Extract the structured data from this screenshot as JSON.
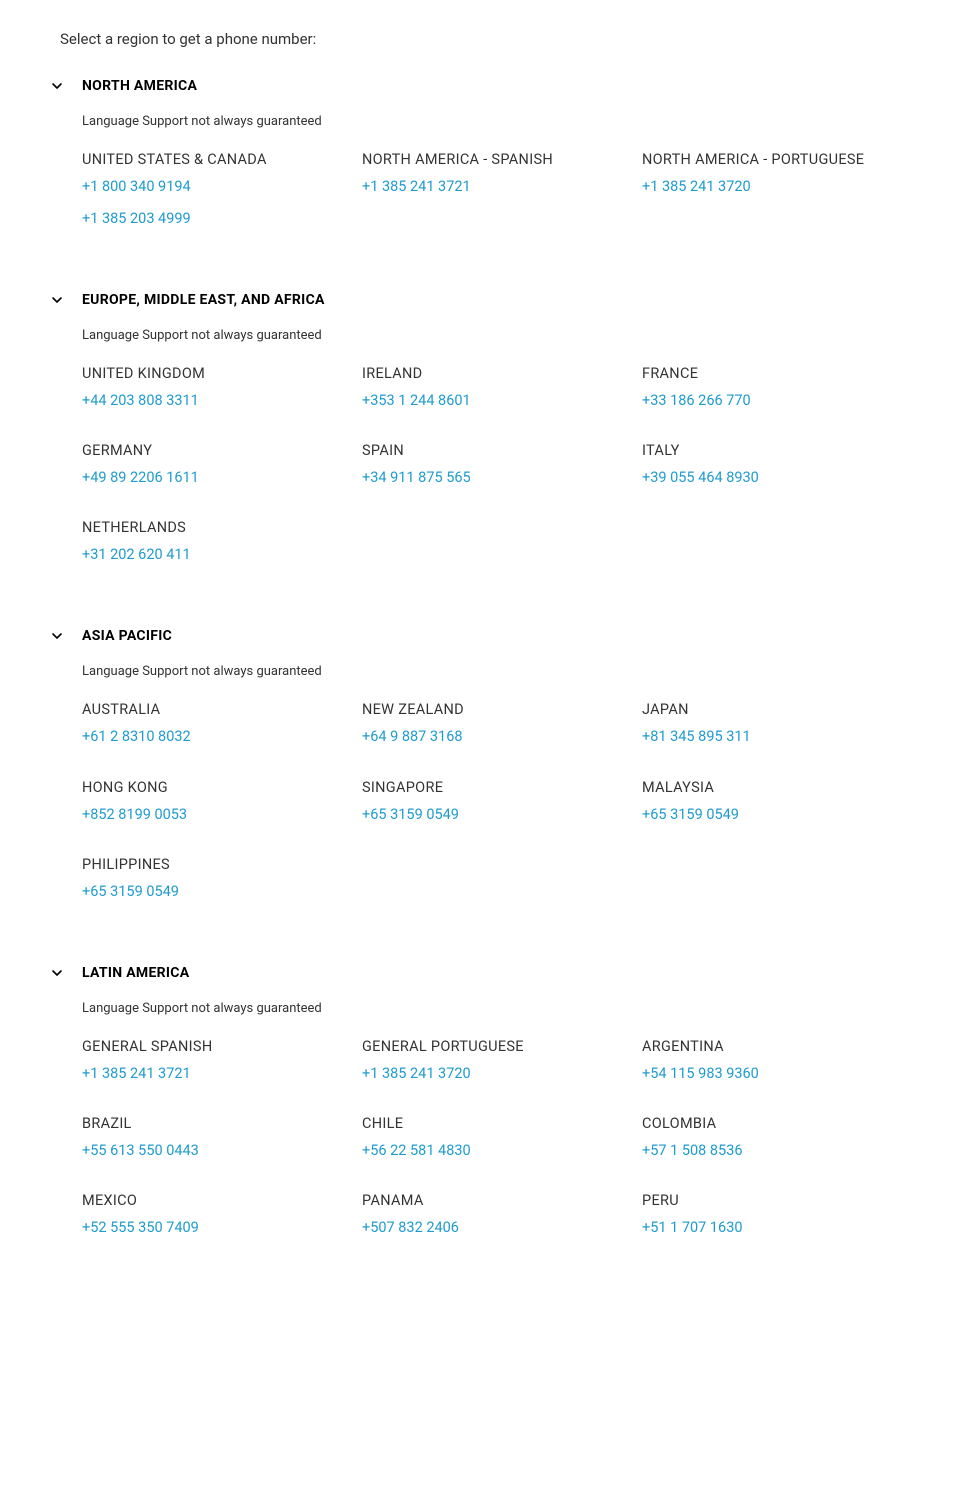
{
  "intro": "Select a region to get a phone number:",
  "note": "Language Support not always guaranteed",
  "regions": [
    {
      "title": "NORTH AMERICA",
      "countries": [
        {
          "name": "UNITED STATES & CANADA",
          "phones": [
            "+1 800 340 9194",
            "+1 385 203 4999"
          ]
        },
        {
          "name": "NORTH AMERICA - SPANISH",
          "phones": [
            "+1 385 241 3721"
          ]
        },
        {
          "name": "NORTH AMERICA - PORTUGUESE",
          "phones": [
            "+1 385 241 3720"
          ]
        }
      ]
    },
    {
      "title": "EUROPE, MIDDLE EAST, AND AFRICA",
      "countries": [
        {
          "name": "UNITED KINGDOM",
          "phones": [
            "+44 203 808 3311"
          ]
        },
        {
          "name": "IRELAND",
          "phones": [
            "+353 1 244 8601"
          ]
        },
        {
          "name": "FRANCE",
          "phones": [
            "+33 186 266 770"
          ]
        },
        {
          "name": "GERMANY",
          "phones": [
            "+49 89 2206 1611"
          ]
        },
        {
          "name": "SPAIN",
          "phones": [
            "+34 911 875 565"
          ]
        },
        {
          "name": "ITALY",
          "phones": [
            "+39 055 464 8930"
          ]
        },
        {
          "name": "NETHERLANDS",
          "phones": [
            "+31 202 620 411"
          ]
        }
      ]
    },
    {
      "title": "ASIA PACIFIC",
      "countries": [
        {
          "name": "AUSTRALIA",
          "phones": [
            "+61 2 8310 8032"
          ]
        },
        {
          "name": "NEW ZEALAND",
          "phones": [
            "+64 9 887 3168"
          ]
        },
        {
          "name": "JAPAN",
          "phones": [
            "+81 345 895 311"
          ]
        },
        {
          "name": "HONG KONG",
          "phones": [
            "+852 8199 0053"
          ]
        },
        {
          "name": "SINGAPORE",
          "phones": [
            "+65 3159 0549"
          ]
        },
        {
          "name": "MALAYSIA",
          "phones": [
            "+65 3159 0549"
          ]
        },
        {
          "name": "PHILIPPINES",
          "phones": [
            "+65 3159 0549"
          ]
        }
      ]
    },
    {
      "title": "LATIN AMERICA",
      "countries": [
        {
          "name": "GENERAL SPANISH",
          "phones": [
            "+1 385 241 3721"
          ]
        },
        {
          "name": "GENERAL PORTUGUESE",
          "phones": [
            "+1 385 241 3720"
          ]
        },
        {
          "name": "ARGENTINA",
          "phones": [
            "+54 115 983 9360"
          ]
        },
        {
          "name": "BRAZIL",
          "phones": [
            "+55 613 550 0443"
          ]
        },
        {
          "name": "CHILE",
          "phones": [
            "+56 22 581 4830"
          ]
        },
        {
          "name": "COLOMBIA",
          "phones": [
            "+57 1 508 8536"
          ]
        },
        {
          "name": "MEXICO",
          "phones": [
            "+52 555 350 7409"
          ]
        },
        {
          "name": "PANAMA",
          "phones": [
            "+507 832 2406"
          ]
        },
        {
          "name": "PERU",
          "phones": [
            "+51 1 707 1630"
          ]
        }
      ]
    }
  ]
}
